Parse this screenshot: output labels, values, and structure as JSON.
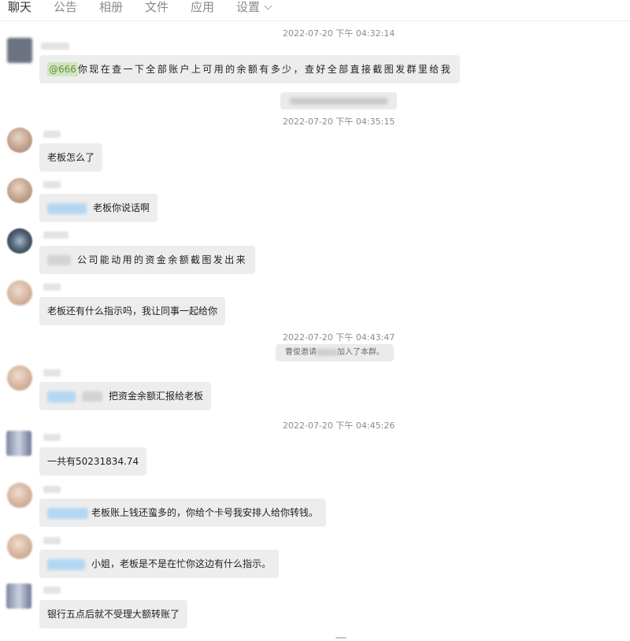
{
  "tabs": [
    "聊天",
    "公告",
    "相册",
    "文件",
    "应用",
    "设置"
  ],
  "timestamps": [
    "2022-07-20 下午 04:32:14",
    "2022-07-20 下午 04:35:15",
    "2022-07-20 下午 04:43:47",
    "2022-07-20 下午 04:45:26"
  ],
  "messages": [
    {
      "mention": "@666",
      "text": "你现在查一下全部账户上可用的余额有多少，查好全部直接截图发群里给我"
    },
    {
      "text": "老板怎么了"
    },
    {
      "text": "老板你说话啊"
    },
    {
      "text": "公司能动用的资金余额截图发出来"
    },
    {
      "text": "老板还有什么指示吗，我让同事一起给你"
    },
    {
      "text": "把资金余额汇报给老板"
    },
    {
      "text": "一共有50231834.74"
    },
    {
      "text": "老板账上钱还蛮多的，你给个卡号我安排人给你转钱。"
    },
    {
      "text": "小姐，老板是不是在忙你这边有什么指示。"
    },
    {
      "text": "银行五点后就不受理大额转账了"
    }
  ],
  "system_notice": {
    "prefix": "曹俊邀请",
    "suffix": "加入了本群。"
  },
  "colors": {
    "bubble": "#ededed",
    "mention_bg": "#cfe6bd",
    "blur_blue": "#b3d7f2"
  }
}
